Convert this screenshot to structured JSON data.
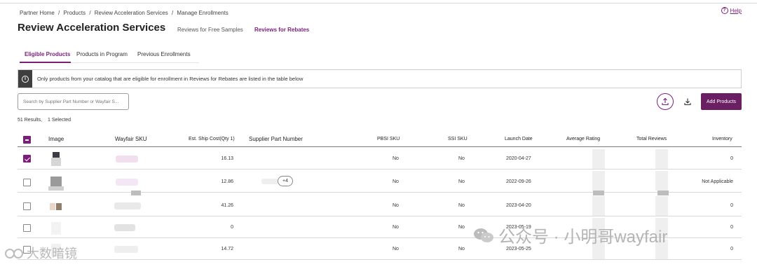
{
  "breadcrumb": [
    "Partner Home",
    "/",
    "Products",
    "/",
    "Review Acceleration Services",
    "/",
    "Manage Enrollments"
  ],
  "help": {
    "icon": "question-circle-icon",
    "label": "Help"
  },
  "page_title": "Review Acceleration Services",
  "header_tabs": [
    "Reviews for Free Samples",
    "Reviews for Rebates"
  ],
  "active_header_tab": "Reviews for Rebates",
  "sub_tabs": [
    "Eligible Products",
    "Products in Program",
    "Previous Enrollments"
  ],
  "active_sub_tab": "Eligible Products",
  "info_message": "Only products from your catalog that are eligible for enrollment in Reviews for Rebates are listed in the table below",
  "search": {
    "placeholder": "Search by Supplier Part Number or Wayfair S..."
  },
  "toolbar": {
    "upload_icon": "upload-icon",
    "download_icon": "download-icon",
    "add_label": "Add Products"
  },
  "results": {
    "count": "51 Results,",
    "selected": "1 Selected"
  },
  "table": {
    "columns": [
      "Image",
      "Wayfair SKU",
      "Est. Ship Cost(Qty 1)",
      "Supplier Part Number",
      "PBSI SKU",
      "SSI SKU",
      "Launch Date",
      "Average Rating",
      "Total Reviews",
      "Inventory"
    ],
    "rows": [
      {
        "checked": true,
        "ship_cost": "16.13",
        "spn_extra": "",
        "pbsi": "No",
        "ssi": "No",
        "launch_date": "2020-04-27",
        "inventory": "0"
      },
      {
        "checked": false,
        "ship_cost": "12.86",
        "spn_extra": "+4",
        "pbsi": "No",
        "ssi": "No",
        "launch_date": "2022-09-26",
        "inventory": "Not Applicable"
      },
      {
        "checked": false,
        "ship_cost": "41.26",
        "spn_extra": "",
        "pbsi": "No",
        "ssi": "No",
        "launch_date": "2023-04-20",
        "inventory": "0"
      },
      {
        "checked": false,
        "ship_cost": "0",
        "spn_extra": "",
        "pbsi": "No",
        "ssi": "No",
        "launch_date": "2023-05-19",
        "inventory": "0"
      },
      {
        "checked": false,
        "ship_cost": "14.72",
        "spn_extra": "",
        "pbsi": "No",
        "ssi": "No",
        "launch_date": "2023-05-25",
        "inventory": "0"
      }
    ]
  },
  "watermarks": {
    "right": "公众号 · 小明哥wayfair",
    "left": "大数暗镜"
  },
  "colors": {
    "accent": "#7b1f7a",
    "button": "#6b1f63"
  }
}
